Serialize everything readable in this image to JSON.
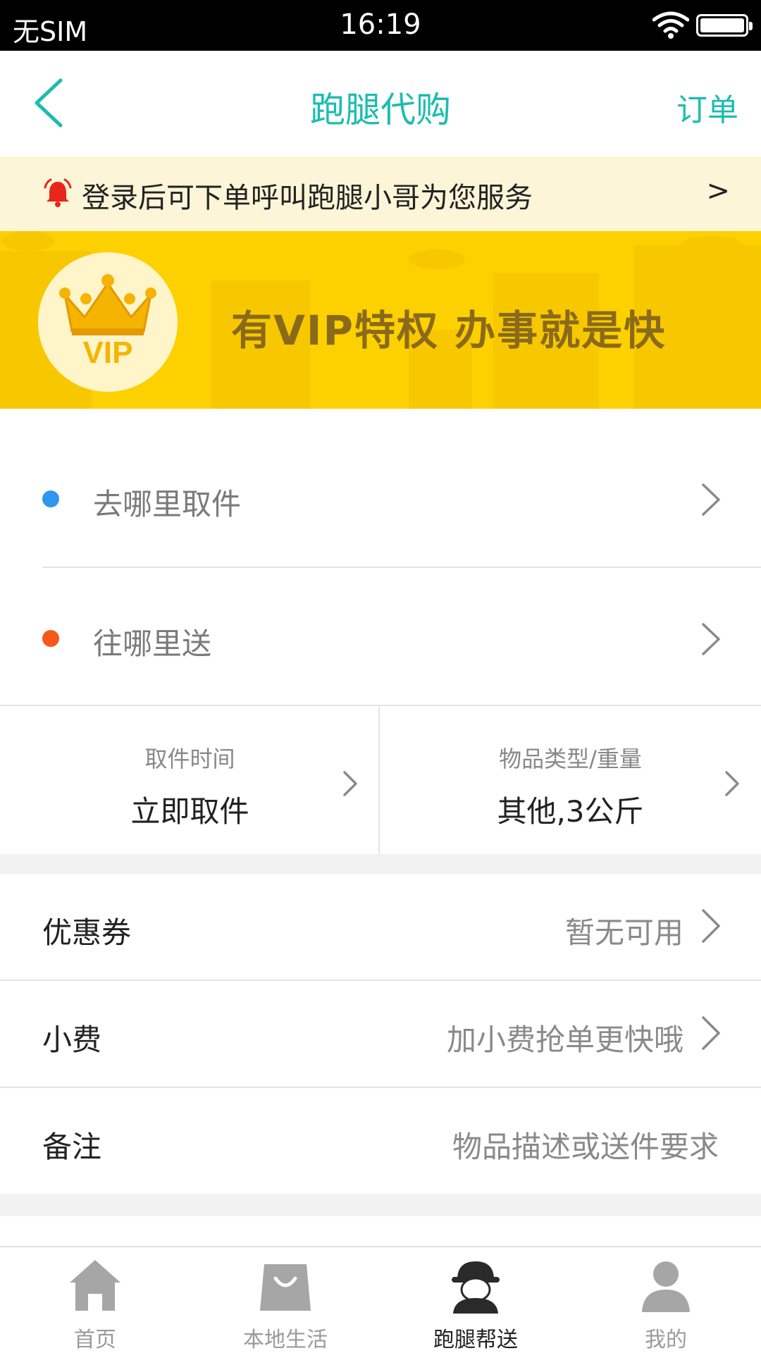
{
  "status_bar": {
    "carrier": "无SIM",
    "time": "16:19"
  },
  "nav": {
    "title": "跑腿代购",
    "right_action": "订单"
  },
  "notice": {
    "text": "登录后可下单呼叫跑腿小哥为您服务",
    "arrow": ">"
  },
  "vip_banner": {
    "badge": "VIP",
    "slogan": "有VIP特权  办事就是快",
    "color": "#fdd000"
  },
  "address": {
    "pickup": {
      "label": "去哪里取件",
      "dot_color": "#2f95ee"
    },
    "deliver": {
      "label": "往哪里送",
      "dot_color": "#f5581b"
    }
  },
  "pickup_time": {
    "caption": "取件时间",
    "value": "立即取件"
  },
  "item_type": {
    "caption": "物品类型/重量",
    "value": "其他,3公斤"
  },
  "rows": {
    "coupon": {
      "label": "优惠券",
      "value": "暂无可用"
    },
    "tip": {
      "label": "小费",
      "value": "加小费抢单更快哦"
    },
    "note": {
      "label": "备注",
      "placeholder": "物品描述或送件要求"
    }
  },
  "tabs": [
    {
      "label": "首页",
      "icon": "home-icon"
    },
    {
      "label": "本地生活",
      "icon": "shopping-bag-icon"
    },
    {
      "label": "跑腿帮送",
      "icon": "courier-icon",
      "active": true
    },
    {
      "label": "我的",
      "icon": "user-icon"
    }
  ],
  "colors": {
    "accent": "#1bbdb0",
    "banner": "#fdd000",
    "notice_bg": "#fdf5d7"
  }
}
